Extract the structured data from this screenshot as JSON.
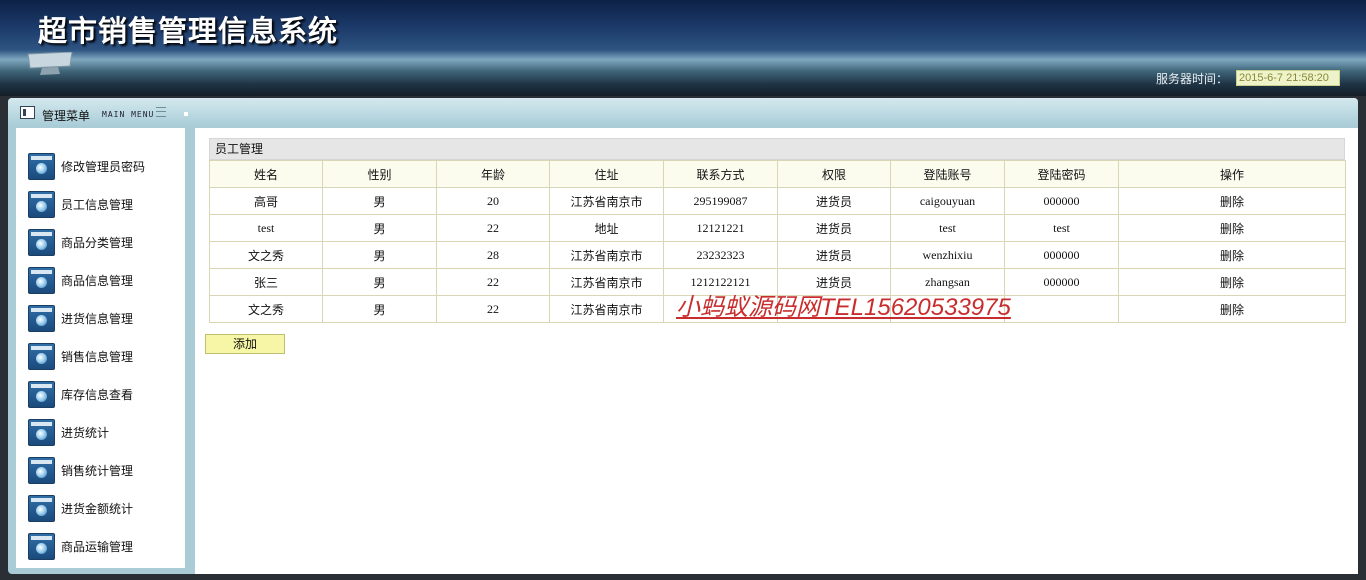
{
  "header": {
    "title": "超市销售管理信息系统",
    "server_time_label": "服务器时间：",
    "server_time_value": "2015-6-7 21:58:20"
  },
  "menu": {
    "title": "管理菜单",
    "subtitle": "MAIN MENU",
    "items": [
      {
        "label": "修改管理员密码",
        "icon": "window-icon"
      },
      {
        "label": "员工信息管理",
        "icon": "window-icon"
      },
      {
        "label": "商品分类管理",
        "icon": "window-icon"
      },
      {
        "label": "商品信息管理",
        "icon": "window-icon"
      },
      {
        "label": "进货信息管理",
        "icon": "window-icon"
      },
      {
        "label": "销售信息管理",
        "icon": "window-icon"
      },
      {
        "label": "库存信息查看",
        "icon": "window-icon"
      },
      {
        "label": "进货统计",
        "icon": "window-icon"
      },
      {
        "label": "销售统计管理",
        "icon": "window-icon"
      },
      {
        "label": "进货金额统计",
        "icon": "window-icon"
      },
      {
        "label": "商品运输管理",
        "icon": "window-icon"
      }
    ]
  },
  "panel": {
    "title": "员工管理",
    "columns": [
      "姓名",
      "性别",
      "年龄",
      "住址",
      "联系方式",
      "权限",
      "登陆账号",
      "登陆密码",
      "操作"
    ],
    "rows": [
      [
        "高哥",
        "男",
        "20",
        "江苏省南京市",
        "295199087",
        "进货员",
        "caigouyuan",
        "000000",
        "删除"
      ],
      [
        "test",
        "男",
        "22",
        "地址",
        "12121221",
        "进货员",
        "test",
        "test",
        "删除"
      ],
      [
        "文之秀",
        "男",
        "28",
        "江苏省南京市",
        "23232323",
        "进货员",
        "wenzhixiu",
        "000000",
        "删除"
      ],
      [
        "张三",
        "男",
        "22",
        "江苏省南京市",
        "1212122121",
        "进货员",
        "zhangsan",
        "000000",
        "删除"
      ],
      [
        "文之秀",
        "男",
        "22",
        "江苏省南京市",
        "",
        "",
        "",
        "",
        "删除"
      ]
    ],
    "add_label": "添加"
  },
  "watermark": "小蚂蚁源码网TEL15620533975",
  "colors": {
    "header_dark": "#0d2147",
    "frame": "#a9ccd6",
    "table_border": "#d9d6b5",
    "add_button": "#f6f6a6",
    "watermark": "#c41616"
  }
}
